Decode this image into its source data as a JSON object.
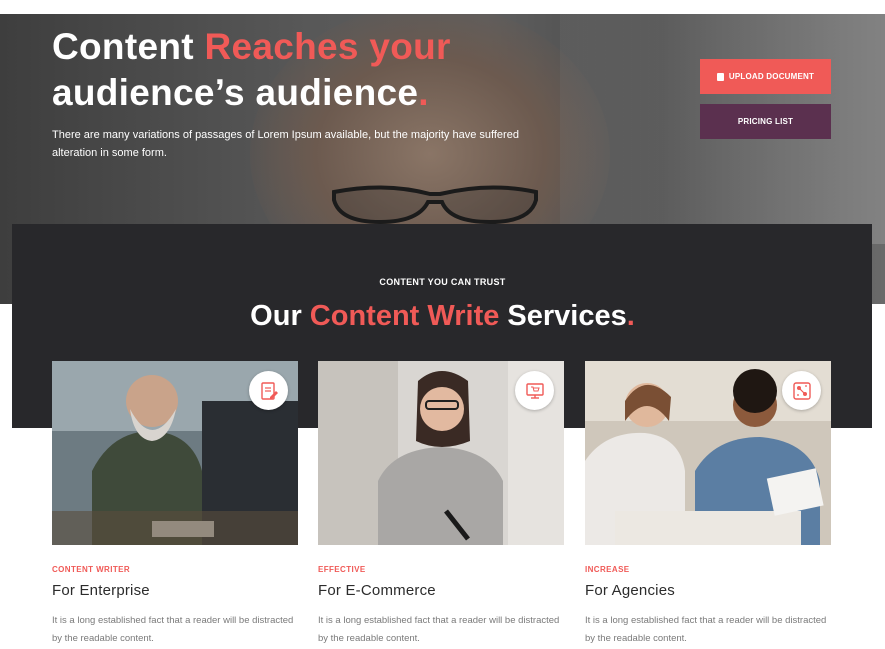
{
  "hero": {
    "title_part1": "Content ",
    "title_accent": "Reaches your",
    "title_part2": "audience’s audience",
    "title_dot": ".",
    "description": "There are many variations of passages of Lorem Ipsum available, but the majority have suffered alteration in some form.",
    "upload_button": "UPLOAD DOCUMENT",
    "pricing_button": "PRICING LIST"
  },
  "services": {
    "eyebrow": "CONTENT YOU CAN TRUST",
    "title_part1": "Our ",
    "title_accent": "Content Write",
    "title_part2": " Services",
    "title_dot": ".",
    "cards": [
      {
        "tag": "CONTENT WRITER",
        "title": "For Enterprise",
        "description": "It is a long established fact that a reader will be distracted by the readable content.",
        "icon": "document-edit-icon"
      },
      {
        "tag": "EFFECTIVE",
        "title": "For E-Commerce",
        "description": "It is a long established fact that a reader will be distracted by the readable content.",
        "icon": "shopping-cart-monitor-icon"
      },
      {
        "tag": "INCREASE",
        "title": "For Agencies",
        "description": "It is a long established fact that a reader will be distracted by the readable content.",
        "icon": "puzzle-network-icon"
      }
    ]
  },
  "colors": {
    "accent": "#f05a57",
    "purple": "#5b304f",
    "dark": "#28282b"
  }
}
